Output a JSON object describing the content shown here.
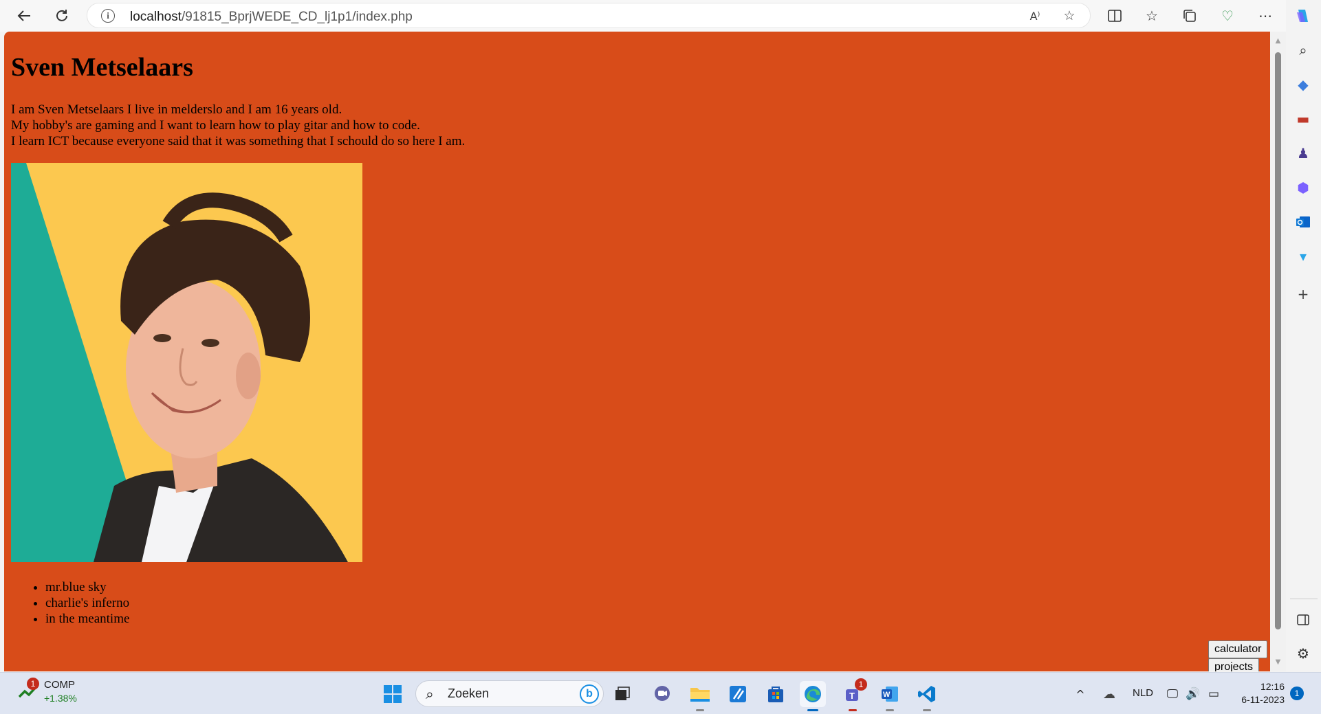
{
  "browser": {
    "url_host": "localhost",
    "url_path": "/91815_BprjWEDE_CD_lj1p1/index.php"
  },
  "page": {
    "title": "Sven Metselaars",
    "bio_lines": [
      "I am Sven Metselaars I live in melderslo and I am 16 years old.",
      "My hobby's are gaming and I want to learn how to play gitar and how to code.",
      "I learn ICT because everyone said that it was something that I schould do so here I am."
    ],
    "songs": [
      "mr.blue sky",
      "charlie's inferno",
      "in the meantime"
    ],
    "buttons": {
      "calculator": "calculator",
      "projects": "projects"
    },
    "background_color": "#d84c19"
  },
  "taskbar": {
    "stock_name": "COMP",
    "stock_change": "+1.38%",
    "stock_badge": "1",
    "search_placeholder": "Zoeken",
    "teams_badge": "1",
    "language": "NLD",
    "time": "12:16",
    "date": "6-11-2023",
    "notification_count": "1"
  }
}
